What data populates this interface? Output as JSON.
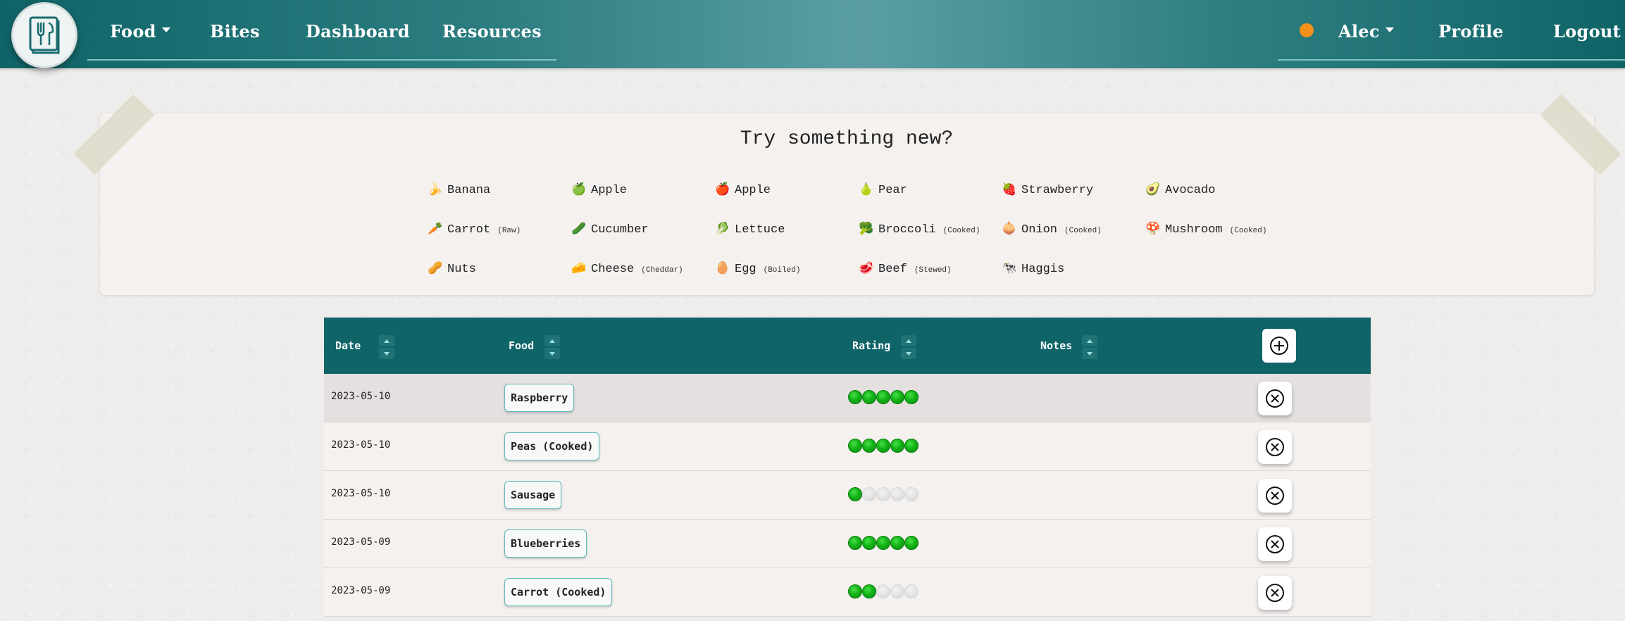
{
  "nav": {
    "logo_icon": "fork-knife-book-icon",
    "left_items": [
      {
        "label": "Food",
        "dropdown": true
      },
      {
        "label": "Bites",
        "dropdown": false
      },
      {
        "label": "Dashboard",
        "dropdown": false
      },
      {
        "label": "Resources",
        "dropdown": false
      }
    ],
    "status_color": "#f39019",
    "user": {
      "label": "Alec",
      "dropdown": true
    },
    "profile": "Profile",
    "logout": "Logout"
  },
  "suggestions": {
    "title": "Try something new?",
    "items": [
      {
        "emoji": "🍌",
        "name": "Banana",
        "note": ""
      },
      {
        "emoji": "🍏",
        "name": "Apple",
        "note": ""
      },
      {
        "emoji": "🍎",
        "name": "Apple",
        "note": ""
      },
      {
        "emoji": "🍐",
        "name": "Pear",
        "note": ""
      },
      {
        "emoji": "🍓",
        "name": "Strawberry",
        "note": ""
      },
      {
        "emoji": "🥑",
        "name": "Avocado",
        "note": ""
      },
      {
        "emoji": "🥕",
        "name": "Carrot",
        "note": "(Raw)"
      },
      {
        "emoji": "🥒",
        "name": "Cucumber",
        "note": ""
      },
      {
        "emoji": "🥬",
        "name": "Lettuce",
        "note": ""
      },
      {
        "emoji": "🥦",
        "name": "Broccoli",
        "note": "(Cooked)"
      },
      {
        "emoji": "🧅",
        "name": "Onion",
        "note": "(Cooked)"
      },
      {
        "emoji": "🍄",
        "name": "Mushroom",
        "note": "(Cooked)"
      },
      {
        "emoji": "🥜",
        "name": "Nuts",
        "note": ""
      },
      {
        "emoji": "🧀",
        "name": "Cheese",
        "note": "(Cheddar)"
      },
      {
        "emoji": "🥚",
        "name": "Egg",
        "note": "(Boiled)"
      },
      {
        "emoji": "🥩",
        "name": "Beef",
        "note": "(Stewed)"
      },
      {
        "emoji": "🐄",
        "name": "Haggis",
        "note": ""
      }
    ]
  },
  "table": {
    "headers": {
      "date": "Date",
      "food": "Food",
      "rating": "Rating",
      "notes": "Notes"
    },
    "rows": [
      {
        "date": "2023-05-10",
        "food": "Raspberry",
        "rating": 5,
        "notes": ""
      },
      {
        "date": "2023-05-10",
        "food": "Peas (Cooked)",
        "rating": 5,
        "notes": ""
      },
      {
        "date": "2023-05-10",
        "food": "Sausage",
        "rating": 1,
        "notes": ""
      },
      {
        "date": "2023-05-09",
        "food": "Blueberries",
        "rating": 5,
        "notes": ""
      },
      {
        "date": "2023-05-09",
        "food": "Carrot (Cooked)",
        "rating": 2,
        "notes": ""
      }
    ],
    "rating_max": 5
  },
  "colors": {
    "header_teal": "#0f6468",
    "rating_green": "#12b316",
    "tag_border": "#5fb8b8"
  }
}
